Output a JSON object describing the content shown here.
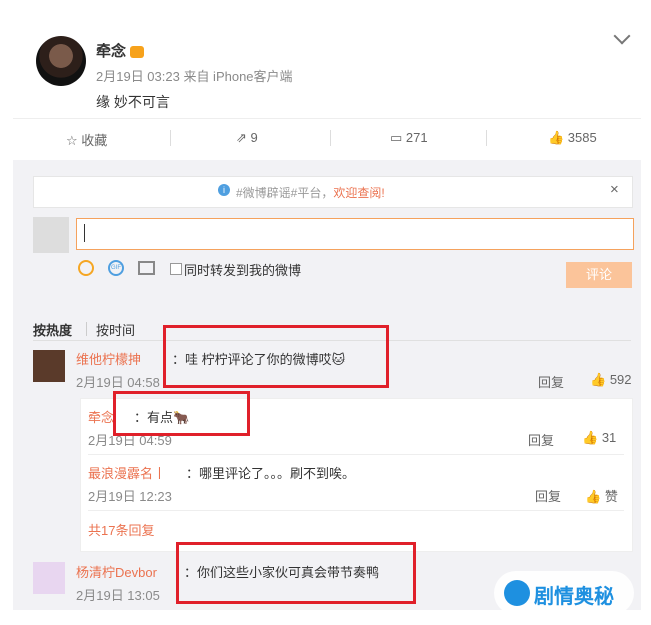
{
  "post": {
    "username": "牵念",
    "meta": "2月19日 03:23 来自 iPhone客户端",
    "text": "缘 妙不可言"
  },
  "actions": {
    "favorite": "☆ 收藏",
    "repost": "⇗ 9",
    "comments": "▭ 271",
    "likes": "👍 3585"
  },
  "notice": {
    "prefix": "#微博辟谣#平台，",
    "link": "欢迎查阅!",
    "close": "×"
  },
  "composer": {
    "repost_label": "同时转发到我的微博",
    "submit": "评论"
  },
  "sort": {
    "hot": "按热度",
    "time": "按时间"
  },
  "comments": [
    {
      "name": "维他柠檬抻",
      "text": "：哇 柠柠评论了你的微博哎🐱",
      "time": "2月19日 04:58",
      "reply": "回复",
      "likes": "592"
    },
    {
      "name": "牵念",
      "text": "：有点🐂",
      "time": "2月19日 04:59",
      "reply": "回复",
      "likes": "31"
    },
    {
      "name": "最浪漫霹名丨",
      "text": "：哪里评论了。。。刷不到唉。",
      "time": "2月19日 12:23",
      "reply": "回复",
      "likes": "赞"
    },
    {
      "name": "杨清柠Devbor",
      "text": "：你们这些小家伙可真会带节奏鸭",
      "time": "2月19日 13:05"
    }
  ],
  "more": "共17条回复",
  "watermark": "剧情奥秘",
  "colors": {
    "accent": "#eb7350",
    "highlight": "#e0202a",
    "input_border": "#f5a25d"
  }
}
